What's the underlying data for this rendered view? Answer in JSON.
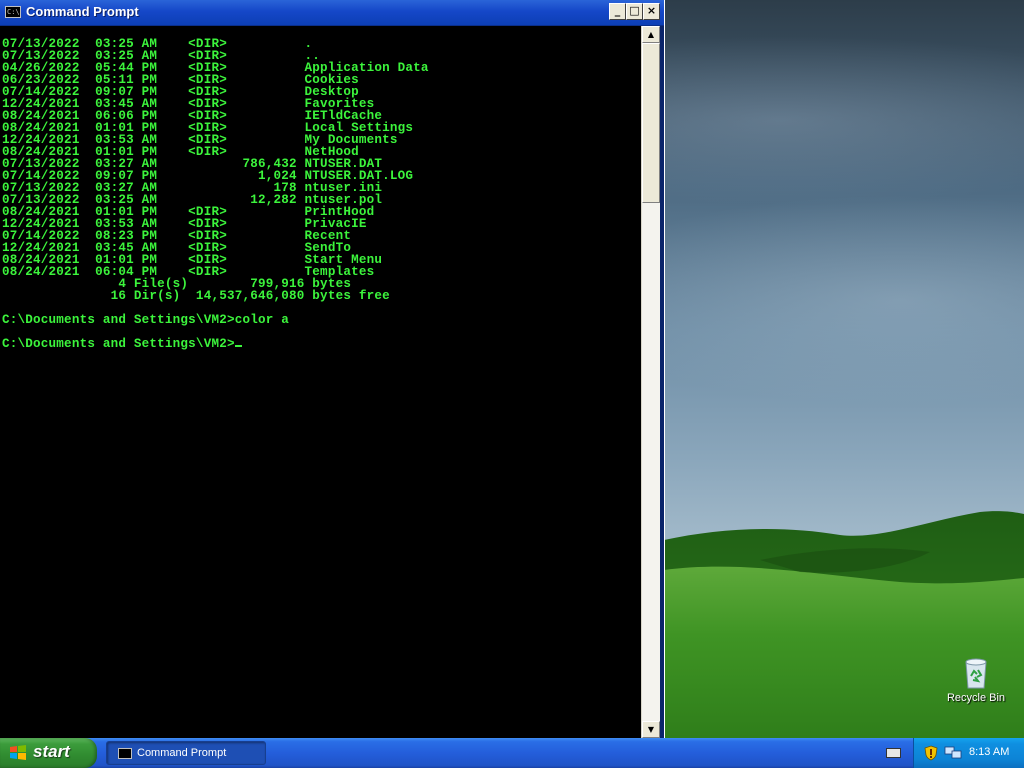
{
  "window": {
    "title": "Command Prompt",
    "buttons": {
      "minimize": "_",
      "maximize": "□",
      "close": "×"
    }
  },
  "console": {
    "lines": [
      "07/13/2022  03:25 AM    <DIR>          .",
      "07/13/2022  03:25 AM    <DIR>          ..",
      "04/26/2022  05:44 PM    <DIR>          Application Data",
      "06/23/2022  05:11 PM    <DIR>          Cookies",
      "07/14/2022  09:07 PM    <DIR>          Desktop",
      "12/24/2021  03:45 AM    <DIR>          Favorites",
      "08/24/2021  06:06 PM    <DIR>          IETldCache",
      "08/24/2021  01:01 PM    <DIR>          Local Settings",
      "12/24/2021  03:53 AM    <DIR>          My Documents",
      "08/24/2021  01:01 PM    <DIR>          NetHood",
      "07/13/2022  03:27 AM           786,432 NTUSER.DAT",
      "07/14/2022  09:07 PM             1,024 NTUSER.DAT.LOG",
      "07/13/2022  03:27 AM               178 ntuser.ini",
      "07/13/2022  03:25 AM            12,282 ntuser.pol",
      "08/24/2021  01:01 PM    <DIR>          PrintHood",
      "12/24/2021  03:53 AM    <DIR>          PrivacIE",
      "07/14/2022  08:23 PM    <DIR>          Recent",
      "12/24/2021  03:45 AM    <DIR>          SendTo",
      "08/24/2021  01:01 PM    <DIR>          Start Menu",
      "08/24/2021  06:04 PM    <DIR>          Templates",
      "               4 File(s)        799,916 bytes",
      "              16 Dir(s)  14,537,646,080 bytes free",
      "",
      "C:\\Documents and Settings\\VM2>color a",
      ""
    ],
    "prompt": "C:\\Documents and Settings\\VM2>",
    "text_color": "#3cf43c",
    "background_color": "#000000"
  },
  "desktop": {
    "recycle_bin_label": "Recycle Bin"
  },
  "taskbar": {
    "start_label": "start",
    "task_label": "Command Prompt",
    "clock": "8:13 AM",
    "icons": [
      "keyboard-icon",
      "shield-icon",
      "network-icon"
    ]
  }
}
